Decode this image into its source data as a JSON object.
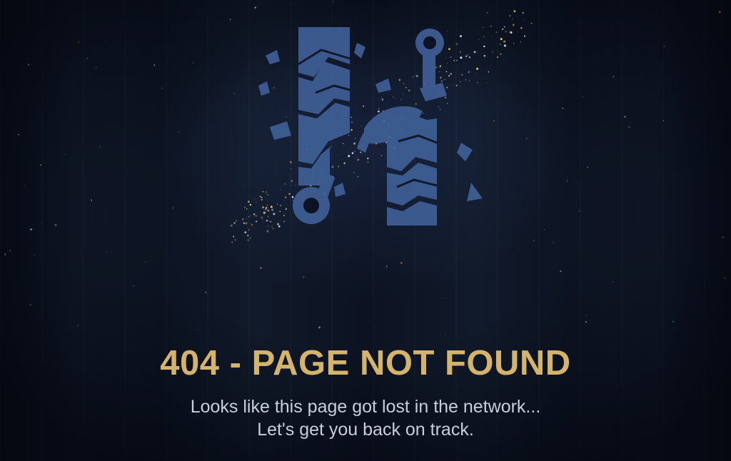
{
  "page": {
    "title": "404 - PAGE NOT FOUND",
    "subtitle_line1": "Looks like this page got lost in the network...",
    "subtitle_line2": "Let's get you back on track."
  },
  "illustration": {
    "icon": "broken-network-node-icon",
    "description_color": "#3f5f95"
  },
  "colors": {
    "background": "#0c1322",
    "accent_gold": "#d4b46a",
    "text_light": "#c9ced8",
    "emblem_blue": "#3f5f95"
  }
}
